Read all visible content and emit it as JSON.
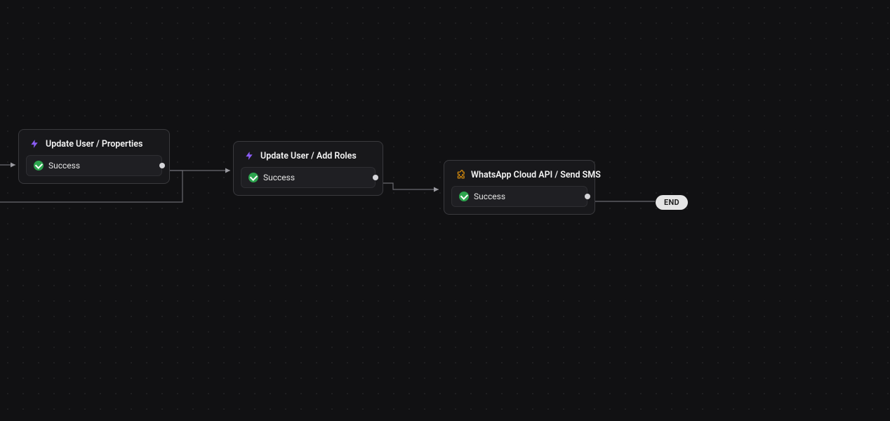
{
  "nodes": {
    "n1": {
      "title": "Update User / Properties",
      "status": "Success",
      "icon": "bolt-icon"
    },
    "n2": {
      "title": "Update User / Add Roles",
      "status": "Success",
      "icon": "bolt-icon"
    },
    "n3": {
      "title": "WhatsApp Cloud API / Send SMS",
      "status": "Success",
      "icon": "puzzle-icon"
    }
  },
  "end": {
    "label": "END"
  },
  "colors": {
    "bolt": "#8b5cf6",
    "puzzle": "#f59e0b",
    "success": "#2da44e",
    "edge": "#6a6a70"
  }
}
